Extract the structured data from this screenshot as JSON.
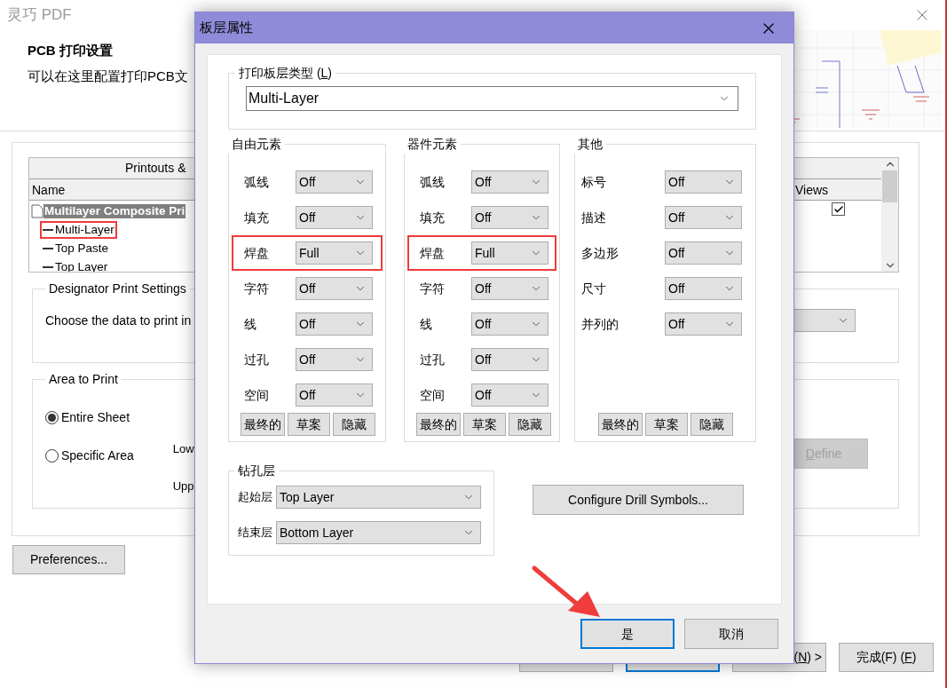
{
  "window": {
    "title": "灵巧 PDF"
  },
  "header": {
    "title": "PCB 打印设置",
    "subtitle": "可以在这里配置打印PCB文"
  },
  "printouts": {
    "heading": "Printouts &",
    "columns": [
      "Name",
      "Views"
    ],
    "views_checked": true,
    "tree": [
      {
        "label": "Multilayer Composite Pri",
        "selected": true,
        "highlighted": false,
        "children": [
          {
            "label": "Multi-Layer",
            "selected": false,
            "highlighted": true
          },
          {
            "label": "Top Paste",
            "selected": false,
            "highlighted": false
          },
          {
            "label": "Top Layer",
            "selected": false,
            "highlighted": false
          }
        ]
      }
    ]
  },
  "designator": {
    "title": "Designator Print Settings",
    "text": "Choose the data to print in"
  },
  "area": {
    "title": "Area to Print",
    "options": [
      {
        "label": "Entire Sheet",
        "selected": true
      },
      {
        "label": "Specific Area",
        "selected": false
      }
    ],
    "coords": [
      "Low",
      "Upp"
    ],
    "define": {
      "key": "D",
      "post": "efine",
      "disabled": true
    }
  },
  "preferences": "Preferences...",
  "footer_buttons": [
    {
      "kind": "covered",
      "default": false
    },
    {
      "kind": "covered",
      "default": true
    },
    {
      "kind": "label",
      "pre": "(",
      "key": "N",
      "post": ") >",
      "default": false
    },
    {
      "kind": "label",
      "pre": "完成(F) (",
      "key": "F",
      "post": ")",
      "default": false
    }
  ],
  "dialog": {
    "title": "板层属性",
    "layer_type": {
      "pre": "打印板层类型 (",
      "key": "L",
      "post": ")",
      "value": "Multi-Layer"
    },
    "groups": [
      {
        "title": "自由元素",
        "rows": [
          {
            "label": "弧线",
            "value": "Off",
            "highlighted": false
          },
          {
            "label": "填充",
            "value": "Off",
            "highlighted": false
          },
          {
            "label": "焊盘",
            "value": "Full",
            "highlighted": true
          },
          {
            "label": "字符",
            "value": "Off",
            "highlighted": false
          },
          {
            "label": "线",
            "value": "Off",
            "highlighted": false
          },
          {
            "label": "过孔",
            "value": "Off",
            "highlighted": false
          },
          {
            "label": "空间",
            "value": "Off",
            "highlighted": false
          }
        ],
        "buttons": [
          "最终的",
          "草案",
          "隐藏"
        ]
      },
      {
        "title": "器件元素",
        "rows": [
          {
            "label": "弧线",
            "value": "Off",
            "highlighted": false
          },
          {
            "label": "填充",
            "value": "Off",
            "highlighted": false
          },
          {
            "label": "焊盘",
            "value": "Full",
            "highlighted": true
          },
          {
            "label": "字符",
            "value": "Off",
            "highlighted": false
          },
          {
            "label": "线",
            "value": "Off",
            "highlighted": false
          },
          {
            "label": "过孔",
            "value": "Off",
            "highlighted": false
          },
          {
            "label": "空间",
            "value": "Off",
            "highlighted": false
          }
        ],
        "buttons": [
          "最终的",
          "草案",
          "隐藏"
        ]
      },
      {
        "title": "其他",
        "rows": [
          {
            "label": "标号",
            "value": "Off",
            "highlighted": false
          },
          {
            "label": "描述",
            "value": "Off",
            "highlighted": false
          },
          {
            "label": "多边形",
            "value": "Off",
            "highlighted": false
          },
          {
            "label": "尺寸",
            "value": "Off",
            "highlighted": false
          },
          {
            "label": "并列的",
            "value": "Off",
            "highlighted": false
          }
        ],
        "buttons": [
          "最终的",
          "草案",
          "隐藏"
        ]
      }
    ],
    "drill": {
      "title": "钻孔层",
      "rows": [
        {
          "label": "起始层",
          "value": "Top Layer"
        },
        {
          "label": "结束层",
          "value": "Bottom Layer"
        }
      ]
    },
    "configure_button": "Configure Drill Symbols...",
    "buttons": [
      {
        "label": "是",
        "default": true
      },
      {
        "label": "取消",
        "default": false
      }
    ]
  }
}
